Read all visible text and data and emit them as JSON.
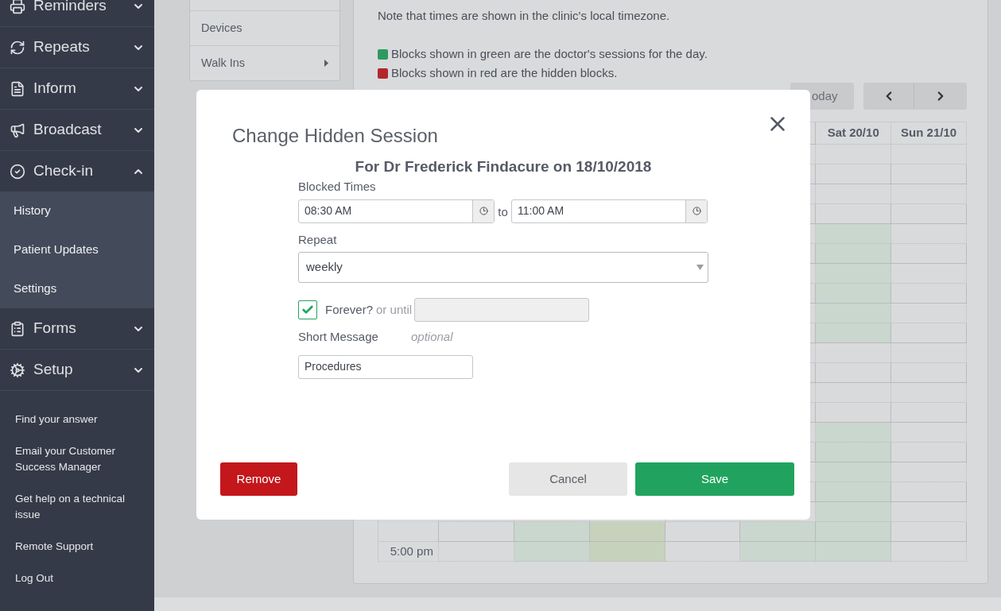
{
  "sidebar": {
    "menu": [
      {
        "label": "Reminders",
        "expanded": false
      },
      {
        "label": "Repeats",
        "expanded": false
      },
      {
        "label": "Inform",
        "expanded": false
      },
      {
        "label": "Broadcast",
        "expanded": false
      },
      {
        "label": "Check-in",
        "expanded": true,
        "children": [
          {
            "label": "History"
          },
          {
            "label": "Patient Updates"
          },
          {
            "label": "Settings"
          }
        ]
      },
      {
        "label": "Forms",
        "expanded": false
      },
      {
        "label": "Setup",
        "expanded": false
      }
    ],
    "links": [
      "Find your answer",
      "Email your Customer Success Manager",
      "Get help on a technical issue",
      "Remote Support",
      "Log Out"
    ]
  },
  "submenu": [
    {
      "label": "Devices",
      "has_arrow": false
    },
    {
      "label": "Walk Ins",
      "has_arrow": true
    }
  ],
  "note": "Note that times are shown in the clinic's local timezone.",
  "legend": [
    {
      "color": "#2f9a5f",
      "text": "Blocks shown in green are the doctor's sessions for the day."
    },
    {
      "color": "#b3262b",
      "text": "Blocks shown in red are the hidden blocks."
    }
  ],
  "calendar": {
    "today": "oday",
    "day_headers": [
      "Sat 20/10",
      "Sun 21/10"
    ],
    "rows": [
      {
        "cells": [
          {
            "kind": "free"
          },
          {
            "kind": "free"
          }
        ]
      },
      {
        "cells": [
          {
            "kind": "free"
          },
          {
            "kind": "free"
          }
        ]
      },
      {
        "cells": [
          {
            "kind": "free"
          },
          {
            "kind": "free"
          }
        ]
      },
      {
        "cells": [
          {
            "kind": "free"
          },
          {
            "kind": "free"
          }
        ]
      },
      {
        "cells": [
          {
            "kind": "session"
          },
          {
            "kind": "free"
          }
        ]
      },
      {
        "cells": [
          {
            "kind": "session"
          },
          {
            "kind": "free"
          }
        ]
      },
      {
        "cells": [
          {
            "kind": "session"
          },
          {
            "kind": "free"
          }
        ]
      },
      {
        "cells": [
          {
            "kind": "session"
          },
          {
            "kind": "free"
          }
        ]
      },
      {
        "cells": [
          {
            "kind": "session"
          },
          {
            "kind": "free"
          }
        ]
      },
      {
        "cells": [
          {
            "kind": "session"
          },
          {
            "kind": "free"
          }
        ]
      },
      {
        "cells": [
          {
            "kind": "free"
          },
          {
            "kind": "free"
          }
        ]
      },
      {
        "cells": [
          {
            "kind": "free"
          },
          {
            "kind": "free"
          }
        ]
      },
      {
        "cells": [
          {
            "kind": "free"
          },
          {
            "kind": "free"
          }
        ]
      },
      {
        "cells": [
          {
            "kind": "free"
          },
          {
            "kind": "free"
          }
        ]
      },
      {
        "cells": [
          {
            "kind": "session"
          },
          {
            "kind": "free"
          }
        ]
      },
      {
        "cells": [
          {
            "kind": "session"
          },
          {
            "kind": "free"
          }
        ]
      },
      {
        "cells": [
          {
            "kind": "session"
          },
          {
            "kind": "free"
          }
        ]
      },
      {
        "cells": [
          {
            "kind": "session"
          },
          {
            "kind": "free"
          }
        ]
      },
      {
        "cells": [
          {
            "kind": "session"
          },
          {
            "kind": "free"
          }
        ]
      },
      {
        "cells": [
          {
            "kind": "free"
          },
          {
            "kind": "session"
          },
          {
            "kind": "overlap"
          },
          {
            "kind": "free"
          },
          {
            "kind": "session"
          },
          {
            "kind": "session"
          },
          {
            "kind": "free"
          }
        ]
      },
      {
        "time": "5:00 pm",
        "cells": [
          {
            "kind": "free"
          },
          {
            "kind": "session"
          },
          {
            "kind": "overlap"
          },
          {
            "kind": "free"
          },
          {
            "kind": "session"
          },
          {
            "kind": "session"
          },
          {
            "kind": "free"
          }
        ]
      }
    ]
  },
  "modal": {
    "title": "Change Hidden Session",
    "subtitle": "For Dr Frederick Findacure on 18/10/2018",
    "blocked_label": "Blocked Times",
    "from": "08:30 AM",
    "separator": "to",
    "until": "11:00 AM",
    "repeat_label": "Repeat",
    "repeat_value": "weekly",
    "forever": {
      "checked": true,
      "label": "Forever?",
      "or_until": "or until"
    },
    "message_label": "Short Message",
    "message_hint": "optional",
    "message": "Procedures",
    "buttons": [
      {
        "label": "Remove",
        "kind": "danger"
      },
      {
        "label": "Cancel",
        "kind": "secondary"
      },
      {
        "label": "Save",
        "kind": "primary"
      }
    ]
  }
}
